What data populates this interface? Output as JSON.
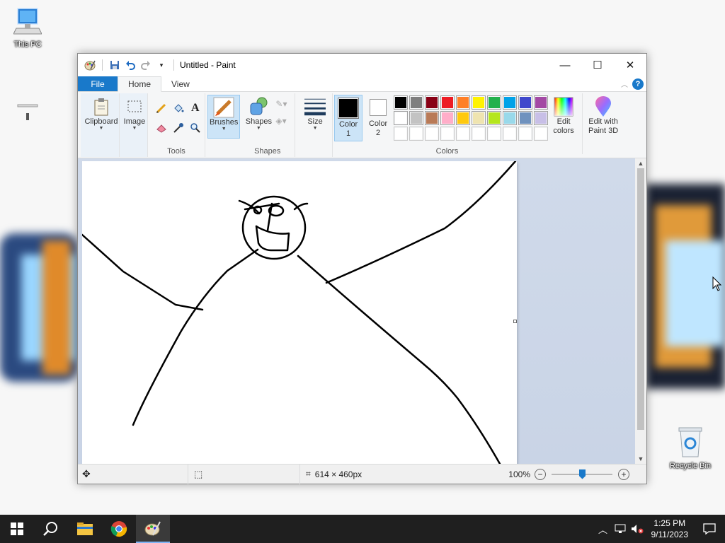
{
  "desktop": {
    "icons": [
      {
        "label": "This PC",
        "icon": "computer-icon"
      },
      {
        "label": "",
        "icon": "shortcut-icon"
      },
      {
        "label": "Recycle Bin",
        "icon": "recycle-bin-icon"
      }
    ]
  },
  "window": {
    "title": "Untitled - Paint",
    "tabs": {
      "file": "File",
      "home": "Home",
      "view": "View"
    },
    "controls": {
      "minimize": "—",
      "maximize": "☐",
      "close": "✕"
    },
    "help": "?"
  },
  "ribbon": {
    "clipboard": "Clipboard",
    "image": "Image",
    "tools_label": "Tools",
    "brushes": "Brushes",
    "shapes_button": "Shapes",
    "shapes_label": "Shapes",
    "size": "Size",
    "color1_line1": "Color",
    "color1_line2": "1",
    "color2_line1": "Color",
    "color2_line2": "2",
    "colors_label": "Colors",
    "edit_colors_line1": "Edit",
    "edit_colors_line2": "colors",
    "paint3d_line1": "Edit with",
    "paint3d_line2": "Paint 3D",
    "palette_row1": [
      "#000000",
      "#7f7f7f",
      "#880015",
      "#ed1c24",
      "#ff7f27",
      "#fff200",
      "#22b14c",
      "#00a2e8",
      "#3f48cc",
      "#a349a4"
    ],
    "palette_row2": [
      "#ffffff",
      "#c3c3c3",
      "#b97a57",
      "#ffaec9",
      "#ffc90e",
      "#efe4b0",
      "#b5e61d",
      "#99d9ea",
      "#7092be",
      "#c8bfe7"
    ],
    "palette_row3": [
      "#ffffff",
      "#ffffff",
      "#ffffff",
      "#ffffff",
      "#ffffff",
      "#ffffff",
      "#ffffff",
      "#ffffff",
      "#ffffff",
      "#ffffff"
    ],
    "color1_value": "#000000",
    "color2_value": "#ffffff"
  },
  "status": {
    "canvas_size": "614 × 460px",
    "zoom": "100%"
  },
  "taskbar": {
    "time": "1:25 PM",
    "date": "9/11/2023"
  }
}
